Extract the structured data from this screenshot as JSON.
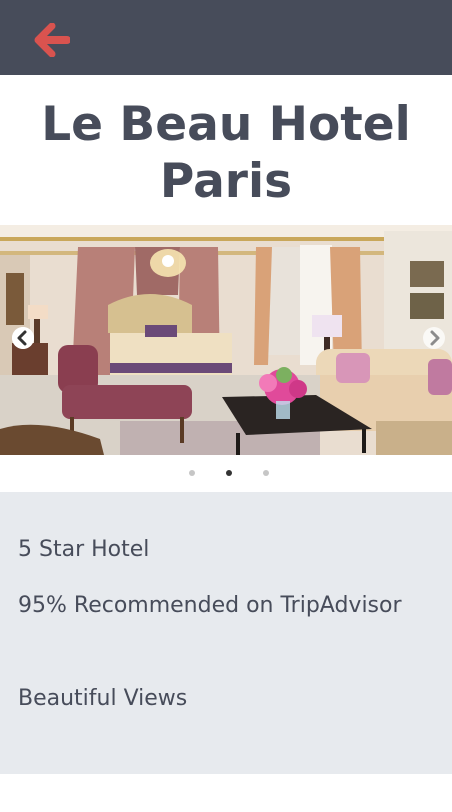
{
  "header": {
    "back_icon": "arrow-left-icon",
    "accent_color": "#d9534f",
    "background_color": "#474c5a"
  },
  "hotel": {
    "title_line1": "Le Beau Hotel",
    "title_line2": "Paris"
  },
  "carousel": {
    "image": "luxury-hotel-suite-photo",
    "prev_icon": "chevron-left-icon",
    "next_icon": "chevron-right-icon",
    "slide_count": 3,
    "active_slide": 2
  },
  "features": [
    {
      "text": "5 Star Hotel"
    },
    {
      "text": "95% Recommended on TripAdvisor"
    },
    {
      "text": "Beautiful Views"
    }
  ]
}
